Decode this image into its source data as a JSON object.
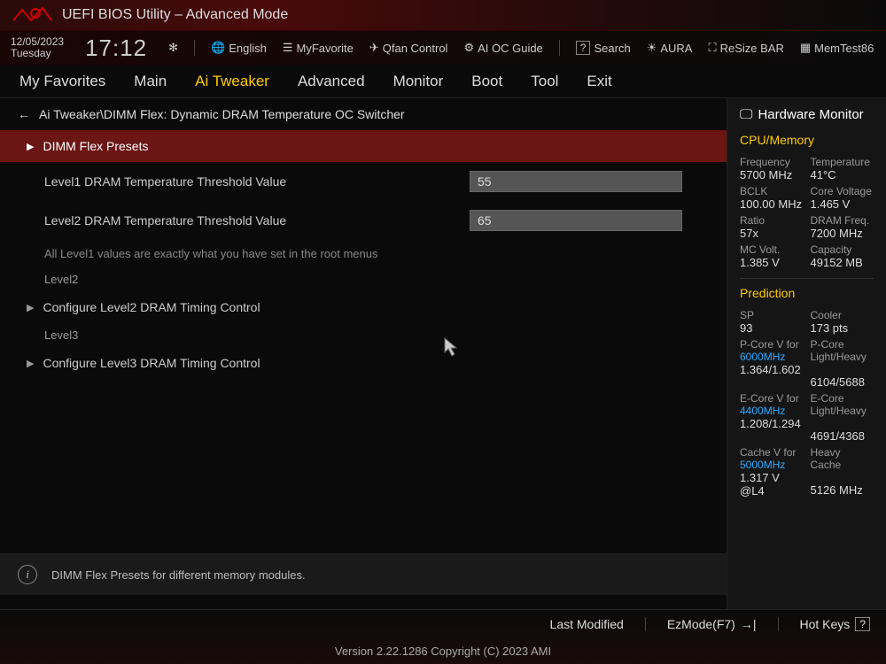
{
  "header": {
    "title": "UEFI BIOS Utility – Advanced Mode"
  },
  "datetime": {
    "date": "12/05/2023",
    "day": "Tuesday",
    "time": "17:12"
  },
  "toolbar": {
    "language": "English",
    "myfavorite": "MyFavorite",
    "qfan": "Qfan Control",
    "aioc": "AI OC Guide",
    "search": "Search",
    "aura": "AURA",
    "resize": "ReSize BAR",
    "memtest": "MemTest86"
  },
  "tabs": [
    "My Favorites",
    "Main",
    "Ai Tweaker",
    "Advanced",
    "Monitor",
    "Boot",
    "Tool",
    "Exit"
  ],
  "active_tab": "Ai Tweaker",
  "breadcrumb": "Ai Tweaker\\DIMM Flex: Dynamic DRAM Temperature OC Switcher",
  "rows": {
    "presets": "DIMM Flex Presets",
    "l1_label": "Level1 DRAM Temperature Threshold Value",
    "l1_value": "55",
    "l2_label": "Level2 DRAM Temperature Threshold Value",
    "l2_value": "65",
    "info": "All Level1 values are exactly what you have set in the root menus",
    "level2": "Level2",
    "cfg_l2": "Configure Level2 DRAM Timing Control",
    "level3": "Level3",
    "cfg_l3": "Configure Level3 DRAM Timing Control"
  },
  "help": "DIMM Flex Presets for different memory modules.",
  "hw": {
    "title": "Hardware Monitor",
    "cpu_section": "CPU/Memory",
    "freq_l": "Frequency",
    "freq_v": "5700 MHz",
    "temp_l": "Temperature",
    "temp_v": "41°C",
    "bclk_l": "BCLK",
    "bclk_v": "100.00 MHz",
    "cvolt_l": "Core Voltage",
    "cvolt_v": "1.465 V",
    "ratio_l": "Ratio",
    "ratio_v": "57x",
    "dram_l": "DRAM Freq.",
    "dram_v": "7200 MHz",
    "mcv_l": "MC Volt.",
    "mcv_v": "1.385 V",
    "cap_l": "Capacity",
    "cap_v": "49152 MB",
    "pred_section": "Prediction",
    "sp_l": "SP",
    "sp_v": "93",
    "cooler_l": "Cooler",
    "cooler_v": "173 pts",
    "pcore_l": "P-Core V for",
    "pcore_f": "6000MHz",
    "pcore_v": "1.364/1.602",
    "pcorelh_l": "P-Core Light/Heavy",
    "pcorelh_v": "6104/5688",
    "ecore_l": "E-Core V for",
    "ecore_f": "4400MHz",
    "ecore_v": "1.208/1.294",
    "ecorelh_l": "E-Core Light/Heavy",
    "ecorelh_v": "4691/4368",
    "cache_l": "Cache V for",
    "cache_f": "5000MHz",
    "cache_v": "1.317 V @L4",
    "heavy_l": "Heavy Cache",
    "heavy_v": "5126 MHz"
  },
  "footer": {
    "last_modified": "Last Modified",
    "ezmode": "EzMode(F7)",
    "hotkeys": "Hot Keys",
    "hotkeys_key": "?",
    "version": "Version 2.22.1286 Copyright (C) 2023 AMI"
  }
}
